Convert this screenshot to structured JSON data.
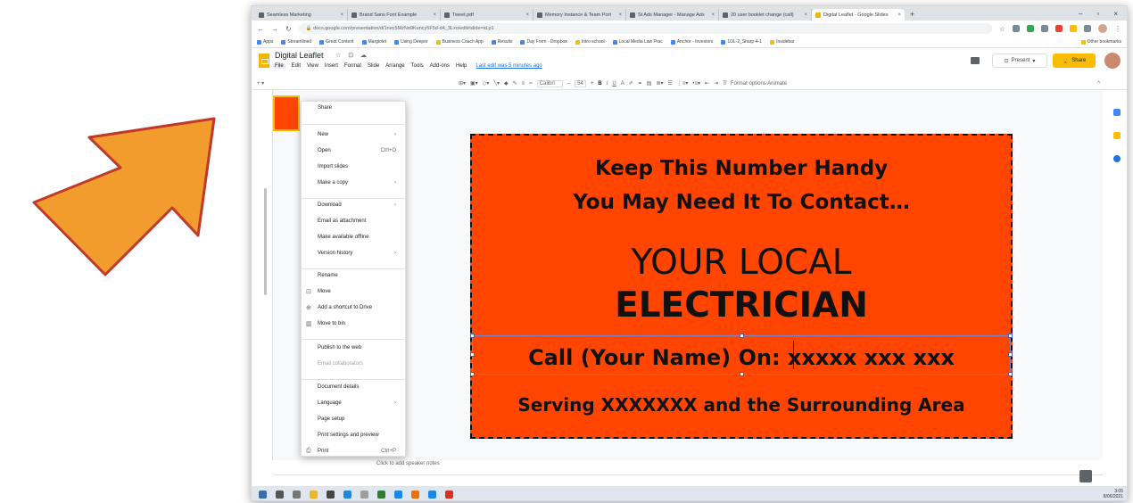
{
  "colors": {
    "arrow_fill": "#f39c2e",
    "arrow_stroke": "#c0392b",
    "slide_bg": "#ff4500",
    "share_btn": "#fbbc04"
  },
  "browser": {
    "tabs": [
      {
        "label": "Seamless Marketing",
        "active": false
      },
      {
        "label": "Brand Sans Font Example",
        "active": false
      },
      {
        "label": "Tweet.pdf",
        "active": false
      },
      {
        "label": "Memory Instance & Team Port",
        "active": false
      },
      {
        "label": "St Ads Manager - Manage Ads",
        "active": false
      },
      {
        "label": "20 user booklet change (call)",
        "active": false
      },
      {
        "label": "Digital Leaflet - Google Slides",
        "active": true
      }
    ],
    "new_tab": "+",
    "url": "docs.google.com/presentation/d/1nec5MzNo9Kuncy5F5d-d4_3Lxo/edit#slide=id.p1",
    "bookmarks": [
      "Apps",
      "Streamlined",
      "Great Content",
      "Margiolet",
      "Using Deeper",
      "Business Coach App",
      "Results",
      "Day Form - Dropbox",
      "Intro school",
      "Local Media Law Prac",
      "Anchor - Investors",
      "1DL-2_Sharp-4-1",
      "Insidebar"
    ],
    "other_bookmarks": "Other bookmarks"
  },
  "slides": {
    "doc_title": "Digital Leaflet",
    "title_icons": "☆ ⊡ ☁",
    "menus": [
      "File",
      "Edit",
      "View",
      "Insert",
      "Format",
      "Slide",
      "Arrange",
      "Tools",
      "Add-ons",
      "Help"
    ],
    "last_edit": "Last edit was 5 minutes ago",
    "present_label": "Present",
    "share_label": "Share",
    "toolbar": {
      "font": "Calibri",
      "size": "54",
      "right": "Format options  Animate"
    },
    "notes_placeholder": "Click to add speaker notes"
  },
  "file_menu": {
    "items": [
      {
        "label": "Share",
        "shortcut": "",
        "icon": "",
        "dim": false
      },
      {
        "label": "New",
        "shortcut": "›",
        "icon": "",
        "dim": false
      },
      {
        "label": "Open",
        "shortcut": "Ctrl+O",
        "icon": "",
        "dim": false
      },
      {
        "label": "Import slides",
        "shortcut": "",
        "icon": "",
        "dim": false
      },
      {
        "label": "Make a copy",
        "shortcut": "›",
        "icon": "",
        "dim": false
      },
      {
        "label": "Download",
        "shortcut": "›",
        "icon": "",
        "dim": false
      },
      {
        "label": "Email as attachment",
        "shortcut": "",
        "icon": "",
        "dim": false
      },
      {
        "label": "Make available offline",
        "shortcut": "",
        "icon": "",
        "dim": false
      },
      {
        "label": "Version history",
        "shortcut": "›",
        "icon": "",
        "dim": false
      },
      {
        "label": "Rename",
        "shortcut": "",
        "icon": "",
        "dim": false
      },
      {
        "label": "Move",
        "shortcut": "",
        "icon": "⊡",
        "dim": false
      },
      {
        "label": "Add a shortcut to Drive",
        "shortcut": "",
        "icon": "⊕",
        "dim": false
      },
      {
        "label": "Move to bin",
        "shortcut": "",
        "icon": "▥",
        "dim": false
      },
      {
        "label": "Publish to the web",
        "shortcut": "",
        "icon": "",
        "dim": false
      },
      {
        "label": "Email collaborators",
        "shortcut": "",
        "icon": "",
        "dim": true
      },
      {
        "label": "Document details",
        "shortcut": "",
        "icon": "",
        "dim": false
      },
      {
        "label": "Language",
        "shortcut": "›",
        "icon": "",
        "dim": false
      },
      {
        "label": "Page setup",
        "shortcut": "",
        "icon": "",
        "dim": false
      },
      {
        "label": "Print settings and preview",
        "shortcut": "",
        "icon": "",
        "dim": false
      },
      {
        "label": "Print",
        "shortcut": "Ctrl+P",
        "icon": "⎙",
        "dim": false
      }
    ]
  },
  "slide_content": {
    "line1": "Keep This Number Handy",
    "line2": "You May Need It To Contact…",
    "line3": "YOUR LOCAL",
    "line4": "ELECTRICIAN",
    "line5": "Call (Your Name) On: xxxxx xxx xxx",
    "line6": "Serving XXXXXXX and the Surrounding Area"
  },
  "taskbar": {
    "clock_time": "3:05",
    "clock_date": "8/06/2021"
  }
}
